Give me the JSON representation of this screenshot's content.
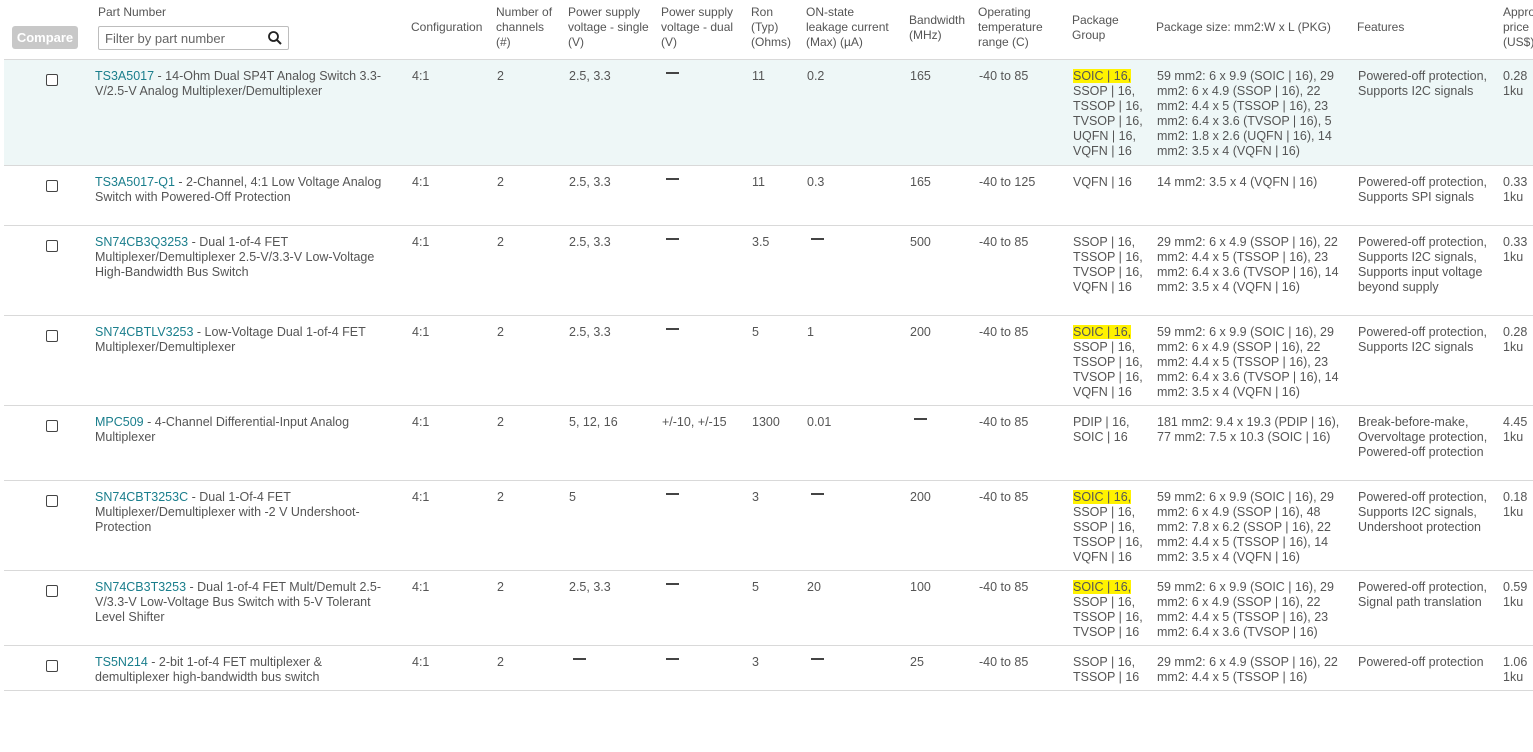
{
  "header": {
    "compare_label": "Compare",
    "part_number": "Part Number",
    "filter_placeholder": "Filter by part number",
    "configuration": "Configuration",
    "channels": "Number of\nchannels\n(#)",
    "supply_single": "Power supply\nvoltage - single\n(V)",
    "supply_dual": "Power supply\nvoltage - dual\n(V)",
    "ron": "Ron\n(Typ)\n(Ohms)",
    "leakage": "ON-state\nleakage current\n(Max) (µA)",
    "bandwidth": "Bandwidth\n(MHz)",
    "temp": "Operating\ntemperature\nrange (C)",
    "package_group": "Package\nGroup",
    "package_size": "Package size: mm2:W x L (PKG)",
    "features": "Features",
    "price": "Approx\nprice\n(US$)"
  },
  "rows": [
    {
      "part": "TS3A5017",
      "desc": " - 14-Ohm Dual SP4T Analog Switch 3.3-V/2.5-V Analog Multiplexer/Demultiplexer",
      "conf": "4:1",
      "chan": "2",
      "single": "2.5, 3.3",
      "dual": "",
      "ron": "11",
      "leak": "0.2",
      "bw": "165",
      "temp": "-40 to 85",
      "pkg": [
        "SOIC | 16,",
        "SSOP | 16,",
        "TSSOP | 16,",
        "TVSOP | 16,",
        "UQFN | 16,",
        "VQFN | 16"
      ],
      "size": "59 mm2: 6 x 9.9 (SOIC | 16), 29 mm2: 6 x 4.9 (SSOP | 16), 22 mm2: 4.4 x 5 (TSSOP | 16), 23 mm2: 6.4 x 3.6 (TVSOP | 16), 5 mm2: 1.8 x 2.6 (UQFN | 16), 14 mm2: 3.5 x 4 (VQFN | 16)",
      "feat": "Powered-off protection, Supports I2C signals",
      "price": "0.28 | 1ku"
    },
    {
      "part": "TS3A5017-Q1",
      "desc": " - 2-Channel, 4:1 Low Voltage Analog Switch with Powered-Off Protection",
      "conf": "4:1",
      "chan": "2",
      "single": "2.5, 3.3",
      "dual": "",
      "ron": "11",
      "leak": "0.3",
      "bw": "165",
      "temp": "-40 to 125",
      "pkg": [
        "VQFN | 16"
      ],
      "size": "14 mm2: 3.5 x 4 (VQFN | 16)",
      "feat": "Powered-off protection, Supports SPI signals",
      "price": "0.33 | 1ku"
    },
    {
      "part": "SN74CB3Q3253",
      "desc": " - Dual 1-of-4 FET Multiplexer/Demultiplexer 2.5-V/3.3-V Low-Voltage High-Bandwidth Bus Switch",
      "conf": "4:1",
      "chan": "2",
      "single": "2.5, 3.3",
      "dual": "",
      "ron": "3.5",
      "leak": "",
      "bw": "500",
      "temp": "-40 to 85",
      "pkg": [
        "SSOP | 16,",
        "TSSOP | 16,",
        "TVSOP | 16,",
        "VQFN | 16"
      ],
      "size": "29 mm2: 6 x 4.9 (SSOP | 16), 22 mm2: 4.4 x 5 (TSSOP | 16), 23 mm2: 6.4 x 3.6 (TVSOP | 16), 14 mm2: 3.5 x 4 (VQFN | 16)",
      "feat": "Powered-off protection, Supports I2C signals, Supports input voltage beyond supply",
      "price": "0.33 | 1ku"
    },
    {
      "part": "SN74CBTLV3253",
      "desc": " - Low-Voltage Dual 1-of-4 FET Multiplexer/Demultiplexer",
      "conf": "4:1",
      "chan": "2",
      "single": "2.5, 3.3",
      "dual": "",
      "ron": "5",
      "leak": "1",
      "bw": "200",
      "temp": "-40 to 85",
      "pkg": [
        "SOIC | 16,",
        "SSOP | 16,",
        "TSSOP | 16,",
        "TVSOP | 16,",
        "VQFN | 16"
      ],
      "size": "59 mm2: 6 x 9.9 (SOIC | 16), 29 mm2: 6 x 4.9 (SSOP | 16), 22 mm2: 4.4 x 5 (TSSOP | 16), 23 mm2: 6.4 x 3.6 (TVSOP | 16), 14 mm2: 3.5 x 4 (VQFN | 16)",
      "feat": "Powered-off protection, Supports I2C signals",
      "price": "0.28 | 1ku"
    },
    {
      "part": "MPC509",
      "desc": " - 4-Channel Differential-Input Analog Multiplexer",
      "conf": "4:1",
      "chan": "2",
      "single": "5, 12, 16",
      "dual": "+/-10, +/-15",
      "ron": "1300",
      "leak": "0.01",
      "bw": "",
      "temp": "-40 to 85",
      "pkg": [
        "PDIP | 16,",
        "SOIC | 16"
      ],
      "size": "181 mm2: 9.4 x 19.3 (PDIP | 16), 77 mm2: 7.5 x 10.3 (SOIC | 16)",
      "feat": "Break-before-make, Overvoltage protection, Powered-off protection",
      "price": "4.45 | 1ku"
    },
    {
      "part": "SN74CBT3253C",
      "desc": " - Dual 1-Of-4 FET Multiplexer/Demultiplexer with -2 V Undershoot-Protection",
      "conf": "4:1",
      "chan": "2",
      "single": "5",
      "dual": "",
      "ron": "3",
      "leak": "",
      "bw": "200",
      "temp": "-40 to 85",
      "pkg": [
        "SOIC | 16,",
        "SSOP | 16,",
        "SSOP | 16,",
        "TSSOP | 16,",
        "VQFN | 16"
      ],
      "size": "59 mm2: 6 x 9.9 (SOIC | 16), 29 mm2: 6 x 4.9 (SSOP | 16), 48 mm2: 7.8 x 6.2 (SSOP | 16), 22 mm2: 4.4 x 5 (TSSOP | 16), 14 mm2: 3.5 x 4 (VQFN | 16)",
      "feat": "Powered-off protection, Supports I2C signals, Undershoot protection",
      "price": "0.18 | 1ku"
    },
    {
      "part": "SN74CB3T3253",
      "desc": " - Dual 1-of-4 FET Mult/Demult 2.5-V/3.3-V Low-Voltage Bus Switch with 5-V Tolerant Level Shifter",
      "conf": "4:1",
      "chan": "2",
      "single": "2.5, 3.3",
      "dual": "",
      "ron": "5",
      "leak": "20",
      "bw": "100",
      "temp": "-40 to 85",
      "pkg": [
        "SOIC | 16,",
        "SSOP | 16,",
        "TSSOP | 16,",
        "TVSOP | 16"
      ],
      "size": "59 mm2: 6 x 9.9 (SOIC | 16), 29 mm2: 6 x 4.9 (SSOP | 16), 22 mm2: 4.4 x 5 (TSSOP | 16), 23 mm2: 6.4 x 3.6 (TVSOP | 16)",
      "feat": "Powered-off protection, Signal path translation",
      "price": "0.59 | 1ku"
    },
    {
      "part": "TS5N214",
      "desc": " - 2-bit 1-of-4 FET multiplexer & demultiplexer high-bandwidth bus switch",
      "conf": "4:1",
      "chan": "2",
      "single": "",
      "dual": "",
      "ron": "3",
      "leak": "",
      "bw": "25",
      "temp": "-40 to 85",
      "pkg": [
        "SSOP | 16,",
        "TSSOP | 16"
      ],
      "size": "29 mm2: 6 x 4.9 (SSOP | 16), 22 mm2: 4.4 x 5 (TSSOP | 16)",
      "feat": "Powered-off protection",
      "price": "1.06 | 1ku"
    }
  ],
  "colors": {
    "link": "#1a7e8c",
    "highlight_row": "#eef7f7",
    "marker": "#fff200"
  }
}
